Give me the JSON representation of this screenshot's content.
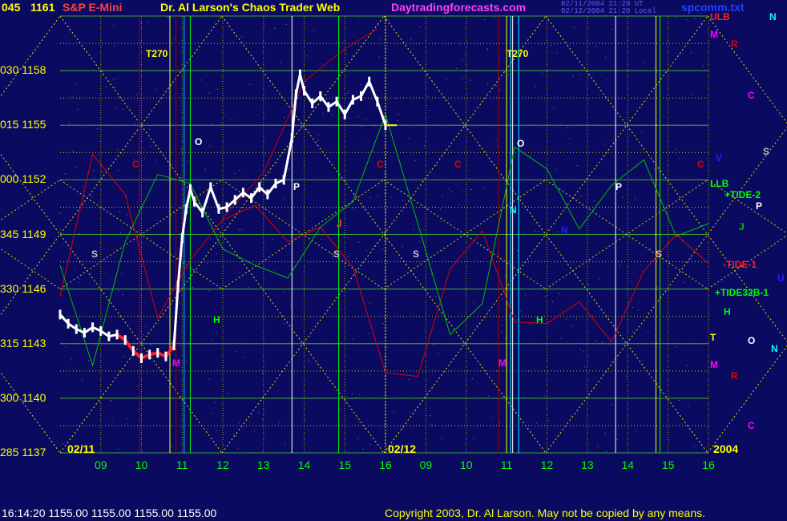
{
  "header": {
    "symbol": "S&P E-Mini",
    "author": "Dr. Al Larson's Chaos Trader Web",
    "site": "Daytradingforecasts.com",
    "stamp1": "02/11/2004 21:20 UT",
    "stamp2": "02/12/2004 21:20 Local",
    "file": "spcomm.txt"
  },
  "status_line": "16:14:20  1155.00 1155.00 1155.00 1155.00",
  "copyright": "Copyright 2003, Dr. Al Larson. May not be copied by any means.",
  "chart_data": {
    "type": "line",
    "title": "S&P E-Mini",
    "y_ticks": [
      {
        "angle": "045",
        "price": 1161
      },
      {
        "angle": "030",
        "price": 1158
      },
      {
        "angle": "015",
        "price": 1155
      },
      {
        "angle": "000",
        "price": 1152
      },
      {
        "angle": "345",
        "price": 1149
      },
      {
        "angle": "330",
        "price": 1146
      },
      {
        "angle": "315",
        "price": 1143
      },
      {
        "angle": "300",
        "price": 1140
      },
      {
        "angle": "285",
        "price": 1137
      }
    ],
    "ylim": [
      1137,
      1161
    ],
    "x_ticks": [
      "09",
      "10",
      "11",
      "12",
      "13",
      "14",
      "15",
      "16",
      "09",
      "10",
      "11",
      "12",
      "13",
      "14",
      "15",
      "16"
    ],
    "x_range_hours": [
      8.0,
      16.0
    ],
    "sessions": [
      "02/11",
      "02/12"
    ],
    "year_label": "2004",
    "right_labels": [
      "ULB",
      "LLB",
      "+TIDE-2",
      "-TIDE-1",
      "+TIDE32B-1",
      "T"
    ],
    "vertical_markers": [
      "T270",
      "T270"
    ],
    "price_series": {
      "name": "E-Mini price",
      "hours": [
        8.0,
        8.2,
        8.4,
        8.6,
        8.8,
        9.0,
        9.2,
        9.4,
        9.6,
        9.8,
        10.0,
        10.2,
        10.4,
        10.6,
        10.8,
        10.9,
        11.0,
        11.1,
        11.2,
        11.3,
        11.5,
        11.7,
        11.9,
        12.1,
        12.3,
        12.5,
        12.7,
        12.9,
        13.1,
        13.3,
        13.5,
        13.7,
        13.8,
        13.9,
        14.0,
        14.2,
        14.4,
        14.6,
        14.8,
        15.0,
        15.2,
        15.4,
        15.6,
        15.8,
        16.0
      ],
      "values": [
        1144.6,
        1144.1,
        1143.8,
        1143.6,
        1143.9,
        1143.7,
        1143.4,
        1143.5,
        1143.2,
        1142.6,
        1142.2,
        1142.4,
        1142.5,
        1142.3,
        1142.9,
        1146.2,
        1148.8,
        1150.4,
        1151.5,
        1150.8,
        1150.2,
        1151.6,
        1150.4,
        1150.5,
        1150.9,
        1151.3,
        1151.0,
        1151.6,
        1151.2,
        1151.8,
        1152.0,
        1154.3,
        1156.7,
        1157.8,
        1156.9,
        1156.2,
        1156.6,
        1156.0,
        1156.3,
        1155.6,
        1156.4,
        1156.6,
        1157.4,
        1156.3,
        1155.0
      ]
    },
    "field_lines": [
      {
        "name": "red field",
        "color": "#e00000",
        "hours": [
          8.0,
          8.8,
          9.6,
          10.4,
          11.2,
          12.0,
          12.8,
          13.6,
          14.4,
          15.2,
          16.0,
          16.8,
          17.6,
          18.4,
          19.2,
          20.0,
          20.8,
          21.6,
          22.4,
          23.2,
          24.0
        ],
        "values": [
          1145.6,
          1153.4,
          1151.2,
          1144.4,
          1147.6,
          1149.8,
          1150.6,
          1148.6,
          1149.4,
          1147.2,
          1141.4,
          1141.2,
          1147.1,
          1149.2,
          1144.2,
          1144.1,
          1145.3,
          1143.1,
          1147.0,
          1149.0,
          1147.4
        ]
      },
      {
        "name": "green field",
        "color": "#00c000",
        "hours": [
          8.0,
          8.8,
          9.6,
          10.4,
          11.2,
          12.0,
          12.8,
          13.6,
          14.4,
          15.2,
          16.0,
          16.8,
          17.6,
          18.4,
          19.2,
          20.0,
          20.8,
          21.6,
          22.4,
          23.2,
          24.0
        ],
        "values": [
          1147.3,
          1141.8,
          1148.6,
          1152.3,
          1151.8,
          1148.2,
          1147.3,
          1146.6,
          1149.4,
          1150.8,
          1155.6,
          1149.6,
          1143.5,
          1145.2,
          1153.8,
          1152.6,
          1149.3,
          1151.7,
          1153.1,
          1148.9,
          1149.6
        ]
      },
      {
        "name": "red rising line",
        "color": "#cc0000",
        "hours": [
          12.0,
          13.0,
          14.0,
          15.0,
          15.8
        ],
        "values": [
          1149.9,
          1152.4,
          1157.4,
          1159.2,
          1160.3
        ]
      }
    ],
    "point_labels": [
      {
        "text": "C",
        "color": "#e00000"
      },
      {
        "text": "C",
        "color": "#e00000"
      },
      {
        "text": "C",
        "color": "#e00000"
      },
      {
        "text": "C",
        "color": "#e00000"
      },
      {
        "text": "O",
        "color": "#ffffff"
      },
      {
        "text": "O",
        "color": "#ffffff"
      },
      {
        "text": "P",
        "color": "#ffffff"
      },
      {
        "text": "P",
        "color": "#ffffff"
      },
      {
        "text": "S",
        "color": "#c0c0c0"
      },
      {
        "text": "S",
        "color": "#c0c0c0"
      },
      {
        "text": "S",
        "color": "#c0c0c0"
      },
      {
        "text": "S",
        "color": "#c0c0c0"
      },
      {
        "text": "H",
        "color": "#00ff00"
      },
      {
        "text": "H",
        "color": "#00ff00"
      },
      {
        "text": "M",
        "color": "#ff00ff"
      },
      {
        "text": "M",
        "color": "#ff00ff"
      },
      {
        "text": "N",
        "color": "#00ffff"
      },
      {
        "text": "J",
        "color": "#ff4040"
      },
      {
        "text": "N",
        "color": "#2020ff"
      }
    ],
    "legend_letters": [
      {
        "text": "N",
        "color": "#00ffff"
      },
      {
        "text": "R",
        "color": "#e00000"
      },
      {
        "text": "C",
        "color": "#ff00ff"
      },
      {
        "text": "V",
        "color": "#2020ff"
      },
      {
        "text": "S",
        "color": "#c0c0c0"
      },
      {
        "text": "P",
        "color": "#ffffff"
      },
      {
        "text": "J",
        "color": "#00c000"
      },
      {
        "text": "U",
        "color": "#2020ff"
      },
      {
        "text": "H",
        "color": "#00ff00"
      },
      {
        "text": "O",
        "color": "#ffffff"
      },
      {
        "text": "N",
        "color": "#00ffff"
      },
      {
        "text": "R",
        "color": "#e00000"
      },
      {
        "text": "C",
        "color": "#ff00ff"
      },
      {
        "text": "M",
        "color": "#ff00ff"
      },
      {
        "text": "M",
        "color": "#ff00ff"
      }
    ],
    "colors": {
      "background": "#0a0a60",
      "price": "#ffffff",
      "low_section": "#ff2020",
      "grid_yellow": "#e0e000",
      "grid_green": "#40c040"
    }
  }
}
